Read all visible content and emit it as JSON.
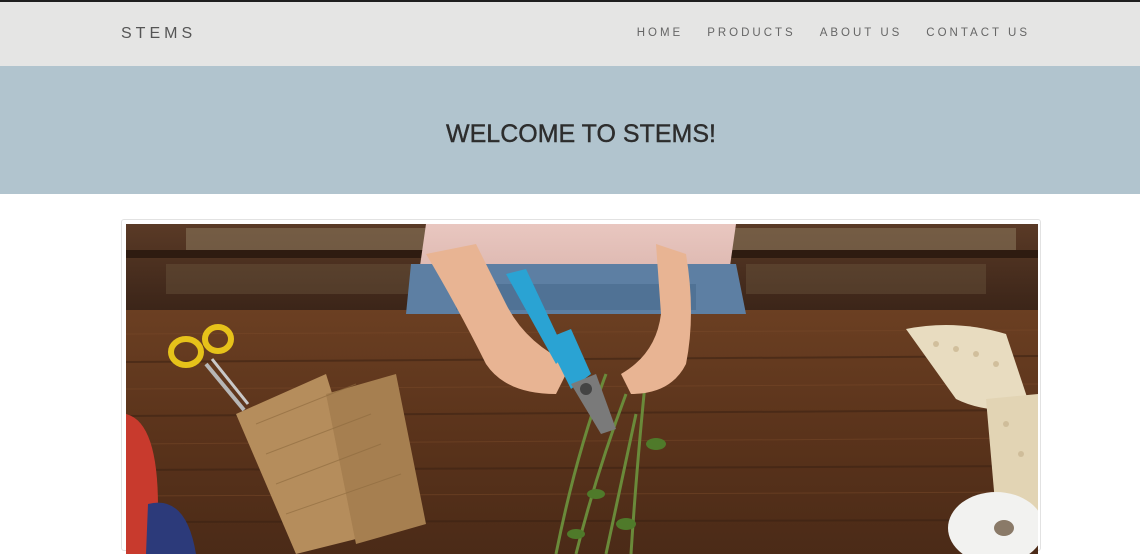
{
  "navbar": {
    "brand": "STEMS",
    "links": [
      "HOME",
      "PRODUCTS",
      "ABOUT US",
      "CONTACT US"
    ]
  },
  "hero": {
    "title": "WELCOME TO STEMS!"
  },
  "colors": {
    "navbar_bg": "#e5e5e4",
    "hero_bg": "#b1c4ce",
    "title_text": "#2d2d2d",
    "nav_text": "#666666"
  },
  "image": {
    "subject": "hands cutting flower stems with blue pruning shears on a wooden table"
  }
}
